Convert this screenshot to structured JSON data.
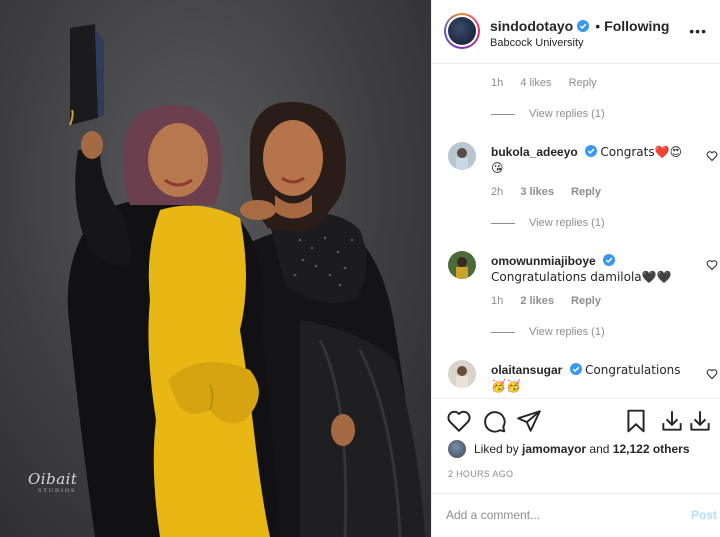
{
  "post": {
    "username": "sindodotayo",
    "following_label": "Following",
    "location": "Babcock University",
    "more_icon": "more-options-icon"
  },
  "comments": {
    "top_meta": {
      "time": "1h",
      "likes": "4 likes",
      "reply": "Reply"
    },
    "top_view_replies": "View replies (1)",
    "items": [
      {
        "username": "bukola_adeeyo",
        "text": "Congrats❤️😍😘",
        "time": "2h",
        "likes": "3 likes",
        "reply": "Reply",
        "view_replies": "View replies (1)"
      },
      {
        "username": "omowunmiajiboye",
        "text": "Congratulations damilola🖤🖤",
        "time": "1h",
        "likes": "2 likes",
        "reply": "Reply",
        "view_replies": "View replies (1)"
      },
      {
        "username": "olaitansugar",
        "text": "Congratulations 🥳🥳"
      }
    ]
  },
  "likes": {
    "prefix": "Liked by",
    "user": "jamomayor",
    "joiner": "and",
    "count": "12,122 others"
  },
  "time_ago": "2 HOURS AGO",
  "add_comment": {
    "placeholder": "Add a comment...",
    "post_label": "Post"
  },
  "watermark": {
    "main": "Oibait",
    "sub": "STUDIOS"
  },
  "colors": {
    "verified": "#3897f0",
    "dress": "#e8b714",
    "background": "#47474a",
    "post_button": "#b2dffc"
  }
}
